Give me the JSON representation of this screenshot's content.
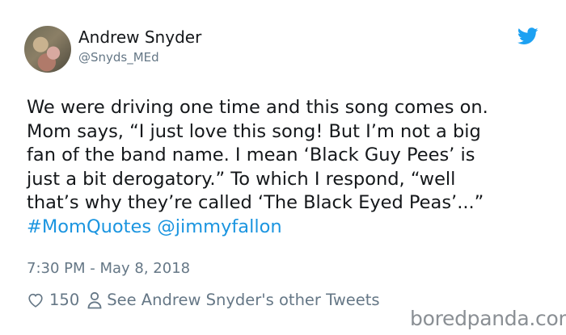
{
  "tweet": {
    "display_name": "Andrew Snyder",
    "handle": "@Snyds_MEd",
    "text_lines": [
      "We were driving one time and this song comes on.",
      "Mom says, “I just love this song! But I’m not a big",
      "fan of the band name. I mean ‘Black Guy Pees’ is",
      "just a bit derogatory.” To which I respond, “well",
      "that’s why they’re called ‘The Black Eyed Peas’...”"
    ],
    "hashtag": "#MomQuotes",
    "mention": "@jimmyfallon",
    "timestamp": "7:30 PM - May 8, 2018",
    "like_count": "150",
    "other_tweets_label": "See Andrew Snyder's other Tweets"
  },
  "watermark": "boredpanda.com",
  "colors": {
    "link": "#1b95e0",
    "secondary_text": "#657786",
    "twitter_blue": "#1da1f2"
  },
  "icons": [
    "twitter-bird-icon",
    "heart-icon",
    "person-icon"
  ]
}
